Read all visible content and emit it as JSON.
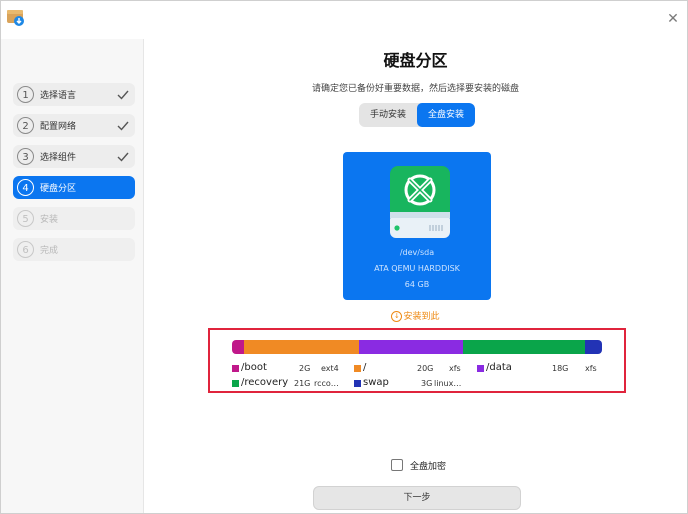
{
  "window": {
    "app_icon": "installer-box-icon",
    "close_icon": "close-icon"
  },
  "sidebar": {
    "steps": [
      {
        "num": "1",
        "label": "选择语言",
        "state": "done"
      },
      {
        "num": "2",
        "label": "配置网络",
        "state": "done"
      },
      {
        "num": "3",
        "label": "选择组件",
        "state": "done"
      },
      {
        "num": "4",
        "label": "硬盘分区",
        "state": "active"
      },
      {
        "num": "5",
        "label": "安装",
        "state": "disabled"
      },
      {
        "num": "6",
        "label": "完成",
        "state": "disabled"
      }
    ]
  },
  "main": {
    "title": "硬盘分区",
    "subtitle": "请确定您已备份好重要数据，然后选择要安装的磁盘",
    "mode_tabs": [
      {
        "label": "手动安装",
        "selected": false
      },
      {
        "label": "全盘安装",
        "selected": true
      }
    ],
    "disk": {
      "path": "/dev/sda",
      "model": "ATA QEMU HARDDISK",
      "size": "64 GB",
      "icon": "hard-disk-icon"
    },
    "boot_location": "安装到此",
    "partitions": [
      {
        "name": "/boot",
        "size": "2G",
        "fs": "ext4",
        "color": "#c0188a",
        "gb": 2
      },
      {
        "name": "/",
        "size": "20G",
        "fs": "xfs",
        "color": "#f08a24",
        "gb": 20
      },
      {
        "name": "/data",
        "size": "18G",
        "fs": "xfs",
        "color": "#8a2be2",
        "gb": 18
      },
      {
        "name": "/recovery",
        "size": "21G",
        "fs": "rcco…",
        "color": "#0aa54a",
        "gb": 21
      },
      {
        "name": "swap",
        "size": "3G",
        "fs": "linux…",
        "color": "#2233b5",
        "gb": 3
      }
    ],
    "encrypt_label": "全盘加密",
    "encrypt_checked": false,
    "next_label": "下一步"
  },
  "colors": {
    "accent": "#0b76f0",
    "highlight_border": "#e0243c",
    "boot_location": "#ee8a14"
  }
}
